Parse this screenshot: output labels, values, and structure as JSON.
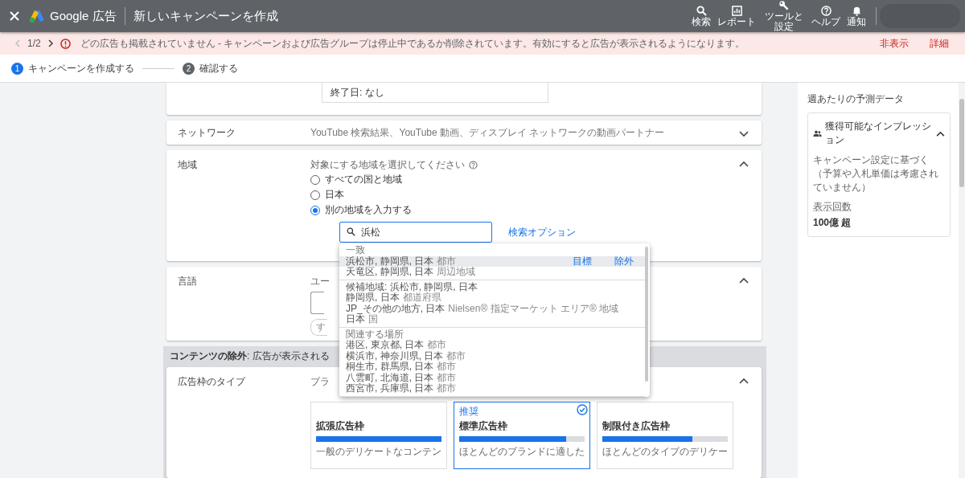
{
  "topbar": {
    "product": "Google 広告",
    "title": "新しいキャンペーンを作成",
    "actions": [
      {
        "kind": "search",
        "label": "検索"
      },
      {
        "kind": "report",
        "label": "レポート"
      },
      {
        "kind": "tools",
        "label": "ツールと設定"
      },
      {
        "kind": "help",
        "label": "ヘルプ"
      },
      {
        "kind": "bell",
        "label": "通知"
      }
    ]
  },
  "alert": {
    "pager": "1/2",
    "message": "どの広告も掲載されていません - キャンペーンおよび広告グループは停止中であるか削除されています。有効にすると広告が表示されるようになります。",
    "actions": [
      "非表示",
      "詳細"
    ]
  },
  "stepper": {
    "steps": [
      {
        "number": "1",
        "label": "キャンペーンを作成する",
        "active": true
      },
      {
        "number": "2",
        "label": "確認する",
        "active": false
      }
    ]
  },
  "end_date": {
    "text": "終了日: なし"
  },
  "network": {
    "label": "ネットワーク",
    "summary": "YouTube 検索結果、YouTube 動画、ディスプレイ ネットワークの動画パートナー",
    "expanded": false
  },
  "location": {
    "label": "地域",
    "question": "対象にする地域を選択してください",
    "expanded": true,
    "options": [
      {
        "label": "すべての国と地域",
        "selected": false
      },
      {
        "label": "日本",
        "selected": false
      },
      {
        "label": "別の地域を入力する",
        "selected": true
      }
    ],
    "search": {
      "value": "浜松"
    },
    "search_options_link": "検索オプション"
  },
  "suggestions": {
    "groups": [
      {
        "heading": "一致",
        "items": [
          {
            "name": "浜松市, 静岡県, 日本",
            "type": "都市",
            "selected": true,
            "actions": [
              "目標",
              "除外"
            ]
          },
          {
            "name": "天竜区, 静岡県, 日本",
            "type": "周辺地域",
            "selected": false
          }
        ]
      },
      {
        "items": [
          {
            "name": "候補地域: 浜松市, 静岡県, 日本",
            "selected": false
          },
          {
            "name": "静岡県, 日本",
            "type": "都道府県",
            "selected": false
          },
          {
            "name": "JP_その他の地方, 日本",
            "type": "Nielsen® 指定マーケット エリア® 地域",
            "selected": false
          },
          {
            "name": "日本",
            "type": "国",
            "selected": false
          }
        ]
      },
      {
        "heading": "関連する場所",
        "items": [
          {
            "name": "港区, 東京都, 日本",
            "type": "都市",
            "selected": false
          },
          {
            "name": "横浜市, 神奈川県, 日本",
            "type": "都市",
            "selected": false
          },
          {
            "name": "桐生市, 群馬県, 日本",
            "type": "都市",
            "selected": false
          },
          {
            "name": "八雲町, 北海道, 日本",
            "type": "都市",
            "selected": false
          },
          {
            "name": "西宮市, 兵庫県, 日本",
            "type": "都市",
            "selected": false
          }
        ]
      }
    ]
  },
  "language": {
    "label": "言語",
    "hint": "ユー",
    "chip": "す",
    "expanded": true
  },
  "exclusion": {
    "heading": "**コンテンツの除外**: 広告が表示される"
  },
  "inventory": {
    "label": "広告枠のタイプ",
    "hint": "ブラ",
    "expanded": true,
    "options": [
      {
        "title": "拡張広告枠",
        "level": 1.0,
        "description": "一般のデリケートなコンテン",
        "selected": false
      },
      {
        "tag": "推奨",
        "title": "標準広告枠",
        "level": 0.85,
        "description": "ほとんどのブランドに適した",
        "selected": true
      },
      {
        "title": "制限付き広告枠",
        "level": 0.72,
        "description": "ほとんどのタイプのデリケー",
        "selected": false
      }
    ]
  },
  "forecast": {
    "title": "週あたりの予測データ",
    "card": {
      "heading": "獲得可能なインプレッション",
      "expanded": true,
      "description": "キャンペーン設定に基づく（予算や入札単価は考慮されていません）",
      "metric_label": "表示回数",
      "metric_value": "100億 超"
    }
  }
}
